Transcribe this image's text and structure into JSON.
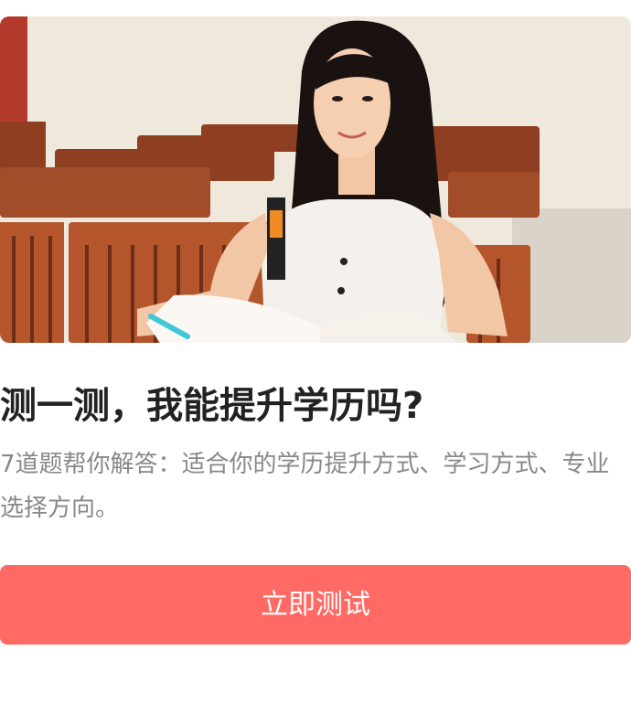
{
  "hero": {
    "image": "student-in-classroom-photo"
  },
  "quiz": {
    "title": "测一测，我能提升学历吗?",
    "description": "7道题帮你解答：适合你的学历提升方式、学习方式、专业选择方向。"
  },
  "cta": {
    "label": "立即测试",
    "color": "#ff6a64"
  }
}
